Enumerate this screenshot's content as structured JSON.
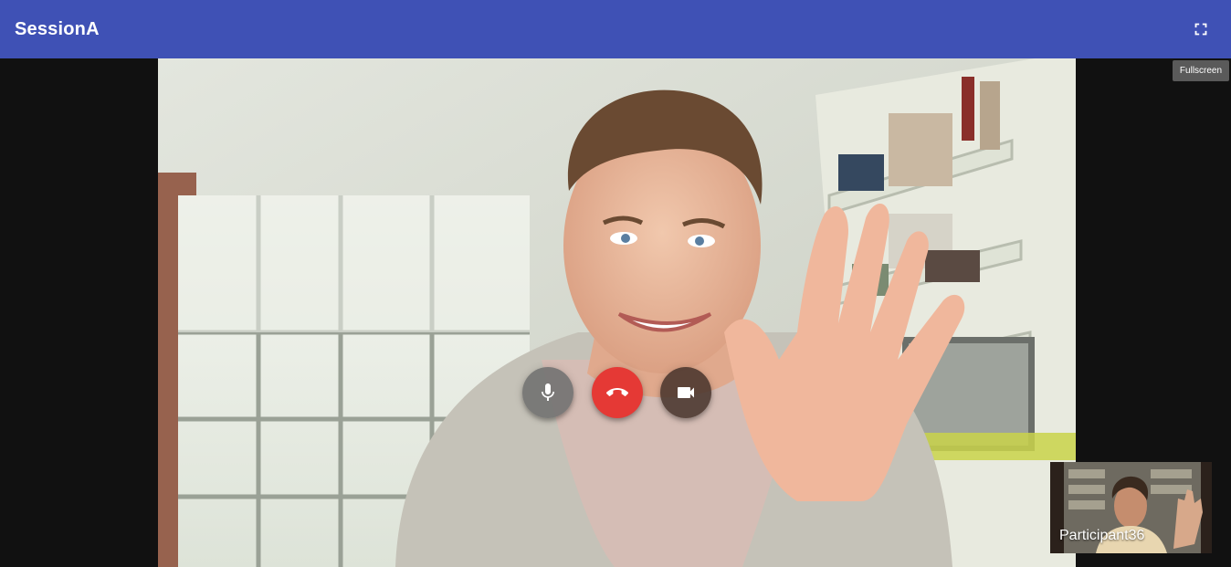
{
  "toolbar": {
    "title": "SessionA",
    "fullscreen_icon": "fullscreen-icon",
    "fullscreen_tooltip": "Fullscreen"
  },
  "controls": {
    "mic_icon": "microphone-icon",
    "hangup_icon": "call-end-icon",
    "camera_icon": "videocam-icon"
  },
  "participants": [
    {
      "name": "Participant36"
    }
  ],
  "colors": {
    "toolbar": "#3f51b5",
    "background": "#111111",
    "hangup": "#e53935",
    "tooltip": "#616161"
  }
}
